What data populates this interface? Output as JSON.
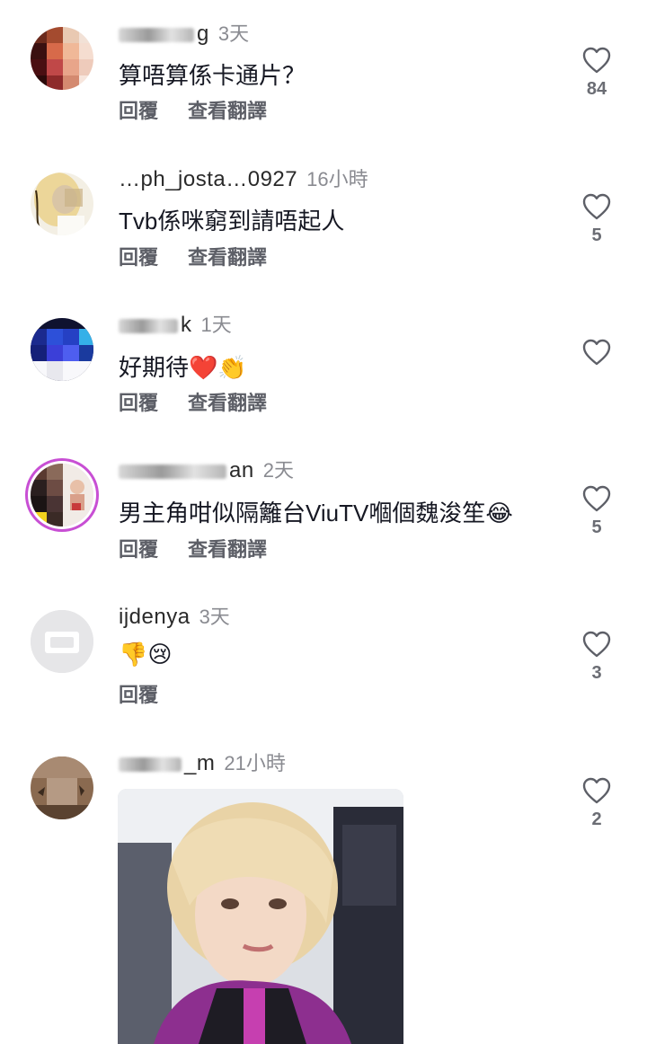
{
  "comments": [
    {
      "username_visible": "g",
      "time": "3天",
      "text": "算唔算係卡通片？",
      "reply": "回覆",
      "translate": "查看翻譯",
      "likes": "84"
    },
    {
      "username_visible": "…ph_josta…0927",
      "time": "16小時",
      "text": "Tvb係咪窮到請唔起人",
      "reply": "回覆",
      "translate": "查看翻譯",
      "likes": "5"
    },
    {
      "username_visible": "k",
      "time": "1天",
      "text": "好期待",
      "text_emoji": "❤️👏",
      "reply": "回覆",
      "translate": "查看翻譯",
      "likes": ""
    },
    {
      "username_visible": "an",
      "time": "2天",
      "text": "男主角咁似隔籬台ViuTV嗰個魏浚笙",
      "text_emoji": "😂",
      "reply": "回覆",
      "translate": "查看翻譯",
      "likes": "5"
    },
    {
      "username_visible": "ijdenya",
      "time": "3天",
      "text": "",
      "text_emoji": "👎😢",
      "reply": "回覆",
      "likes": "3"
    },
    {
      "username_visible": "_m",
      "time": "21小時",
      "likes": "2"
    }
  ],
  "icons": {
    "like": "heart-outline-icon"
  },
  "colors": {
    "text": "#161823",
    "meta": "#8a8b91",
    "action": "#5d5f67"
  }
}
